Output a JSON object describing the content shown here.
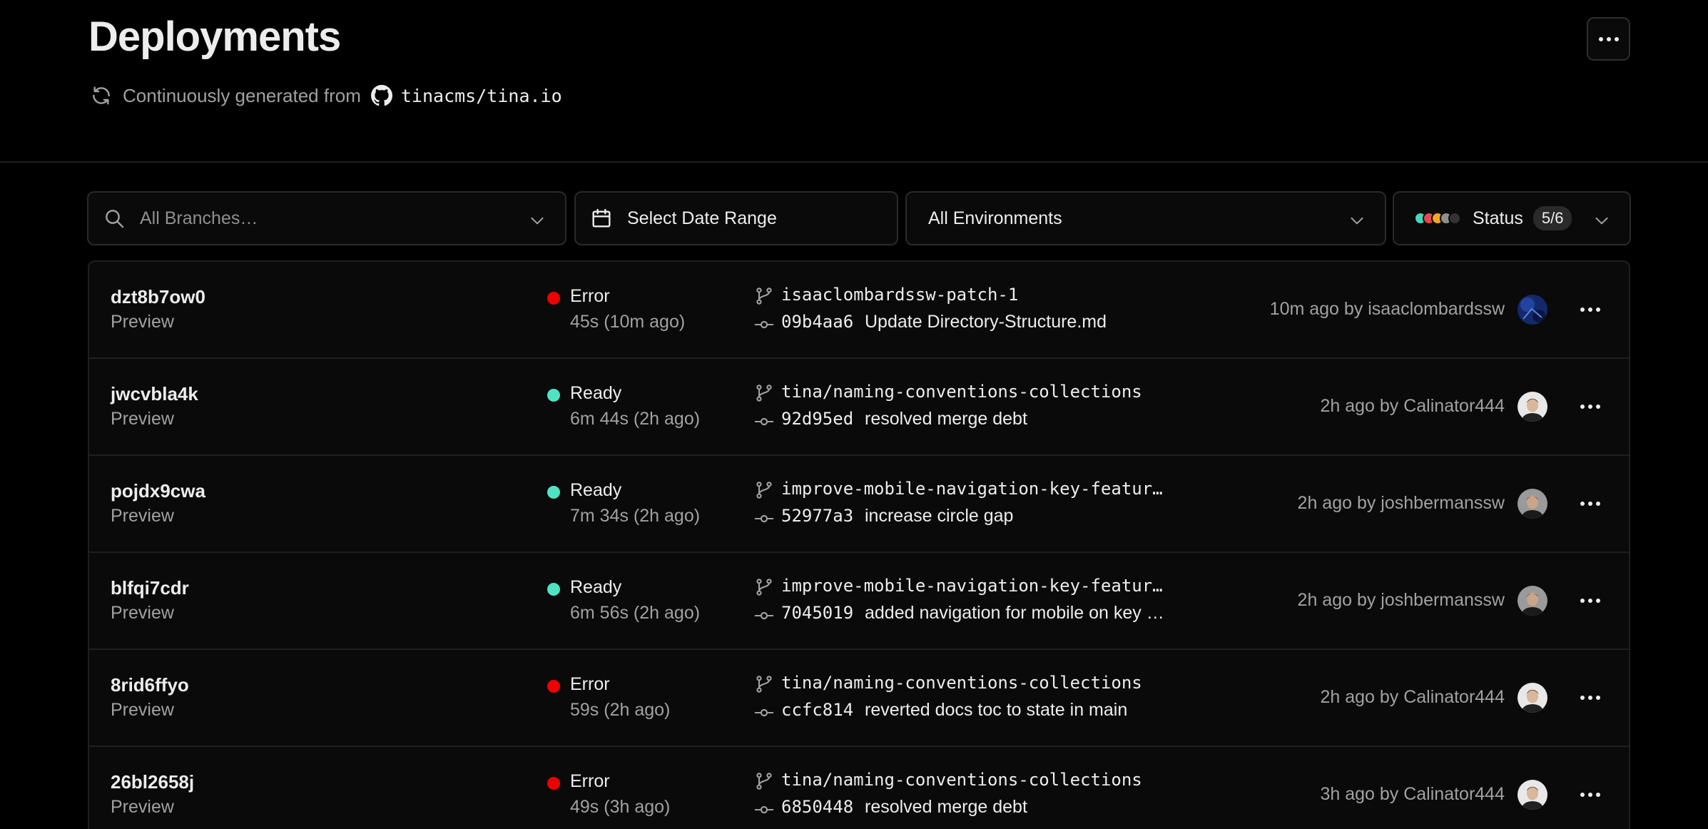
{
  "page": {
    "title": "Deployments",
    "subtitle_prefix": "Continuously generated from",
    "repo": "tinacms/tina.io"
  },
  "filters": {
    "branches_placeholder": "All Branches…",
    "date_range_label": "Select Date Range",
    "environment_label": "All Environments",
    "status_label": "Status",
    "status_count": "5/6",
    "status_colors": [
      "#45d7bc",
      "#e5484d",
      "#f5a623",
      "#8f8f8f",
      "#333333"
    ]
  },
  "status_colors": {
    "Error": "#ee0000",
    "Ready": "#50e3c2"
  },
  "deployments": [
    {
      "id": "dzt8b7ow0",
      "environment": "Preview",
      "status": "Error",
      "duration": "45s (10m ago)",
      "branch": "isaaclombardssw-patch-1",
      "commit_hash": "09b4aa6",
      "commit_message": "Update Directory-Structure.md",
      "meta": "10m ago by isaaclombardssw",
      "avatar": "avatar-blue"
    },
    {
      "id": "jwcvbla4k",
      "environment": "Preview",
      "status": "Ready",
      "duration": "6m 44s (2h ago)",
      "branch": "tina/naming-conventions-collections",
      "commit_hash": "92d95ed",
      "commit_message": "resolved merge debt",
      "meta": "2h ago by Calinator444",
      "avatar": "avatar-person-light"
    },
    {
      "id": "pojdx9cwa",
      "environment": "Preview",
      "status": "Ready",
      "duration": "7m 34s (2h ago)",
      "branch": "improve-mobile-navigation-key-featur…",
      "commit_hash": "52977a3",
      "commit_message": "increase circle gap",
      "meta": "2h ago by joshbermanssw",
      "avatar": "avatar-person-grey"
    },
    {
      "id": "blfqi7cdr",
      "environment": "Preview",
      "status": "Ready",
      "duration": "6m 56s (2h ago)",
      "branch": "improve-mobile-navigation-key-featur…",
      "commit_hash": "7045019",
      "commit_message": "added navigation for mobile on key …",
      "meta": "2h ago by joshbermanssw",
      "avatar": "avatar-person-grey"
    },
    {
      "id": "8rid6ffyo",
      "environment": "Preview",
      "status": "Error",
      "duration": "59s (2h ago)",
      "branch": "tina/naming-conventions-collections",
      "commit_hash": "ccfc814",
      "commit_message": "reverted docs toc to state in main",
      "meta": "2h ago by Calinator444",
      "avatar": "avatar-person-light"
    },
    {
      "id": "26bl2658j",
      "environment": "Preview",
      "status": "Error",
      "duration": "49s (3h ago)",
      "branch": "tina/naming-conventions-collections",
      "commit_hash": "6850448",
      "commit_message": "resolved merge debt",
      "meta": "3h ago by Calinator444",
      "avatar": "avatar-person-light"
    }
  ]
}
